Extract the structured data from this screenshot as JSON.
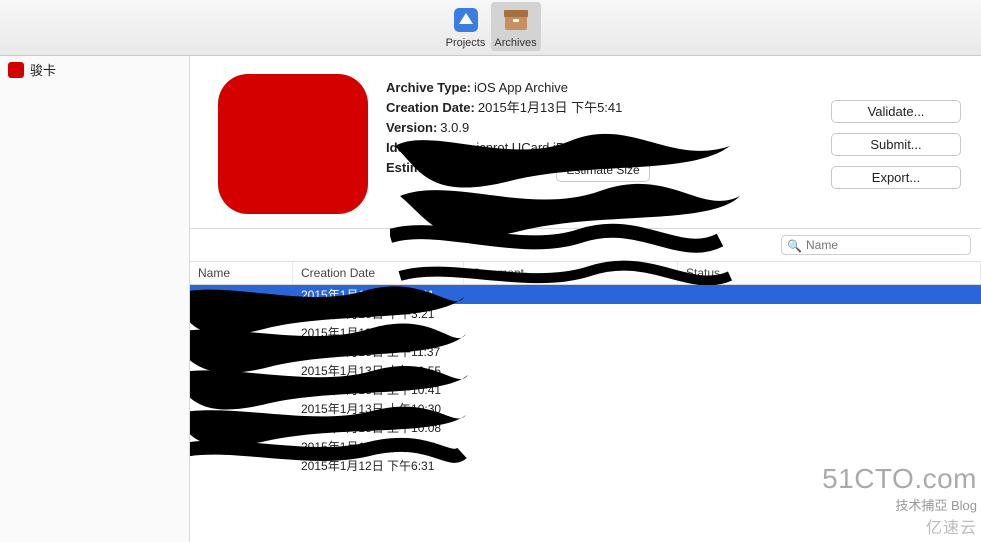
{
  "toolbar": {
    "tabs": [
      {
        "label": "Projects",
        "name": "projects"
      },
      {
        "label": "Archives",
        "name": "archives",
        "selected": true
      }
    ]
  },
  "sidebar": {
    "items": [
      {
        "label": "骏卡"
      }
    ]
  },
  "detail": {
    "archive_type_label": "Archive Type:",
    "archive_type_value": "iOS App Archive",
    "creation_date_label": "Creation Date:",
    "creation_date_value": "2015年1月13日 下午5:41",
    "version_label": "Version:",
    "version_value": "3.0.9",
    "identifier_label": "Identifier:",
    "identifier_value": "com.jcnrot.UCard.iPhone",
    "estimated_label": "Estimated App Store Size:",
    "estimate_button": "Estimate Size"
  },
  "actions": {
    "validate": "Validate...",
    "submit": "Submit...",
    "export": "Export..."
  },
  "search": {
    "placeholder": "Name"
  },
  "table": {
    "headers": {
      "name": "Name",
      "creation_date": "Creation Date",
      "comment": "Comment",
      "status": "Status"
    },
    "rows": [
      {
        "date": "2015年1月13日 下午5:41",
        "selected": true
      },
      {
        "date": "2015年1月13日 下午3:21"
      },
      {
        "date": "2015年1月13日 下午3:13"
      },
      {
        "date": "2015年1月13日 上午11:37"
      },
      {
        "date": "2015年1月13日 上午10:55"
      },
      {
        "date": "2015年1月13日 上午10:41"
      },
      {
        "date": "2015年1月13日 上午10:30"
      },
      {
        "date": "2015年1月13日 上午10:08"
      },
      {
        "date": "2015年1月12日 下午6:37"
      },
      {
        "date": "2015年1月12日 下午6:31"
      }
    ]
  },
  "watermark": {
    "line1": "51CTO.com",
    "line2": "技术捕亞   Blog",
    "line3": "亿速云"
  }
}
